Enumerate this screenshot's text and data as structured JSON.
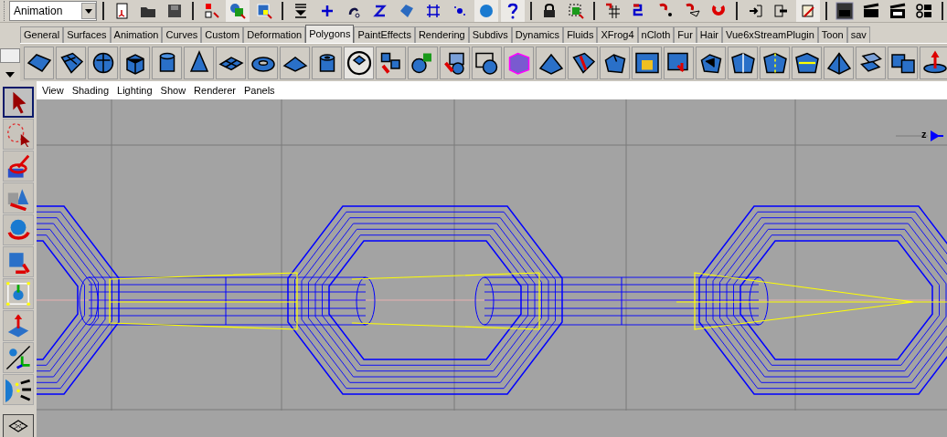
{
  "status_line": {
    "mode_menu": {
      "value": "Animation"
    }
  },
  "shelf": {
    "tabs": [
      {
        "label": "General",
        "selected": false
      },
      {
        "label": "Surfaces",
        "selected": false
      },
      {
        "label": "Animation",
        "selected": false
      },
      {
        "label": "Curves",
        "selected": false
      },
      {
        "label": "Custom",
        "selected": false
      },
      {
        "label": "Deformation",
        "selected": false
      },
      {
        "label": "Polygons",
        "selected": true
      },
      {
        "label": "PaintEffects",
        "selected": false
      },
      {
        "label": "Rendering",
        "selected": false
      },
      {
        "label": "Subdivs",
        "selected": false
      },
      {
        "label": "Dynamics",
        "selected": false
      },
      {
        "label": "Fluids",
        "selected": false
      },
      {
        "label": "XFrog4",
        "selected": false
      },
      {
        "label": "nCloth",
        "selected": false
      },
      {
        "label": "Fur",
        "selected": false
      },
      {
        "label": "Hair",
        "selected": false
      },
      {
        "label": "Vue6xStreamPlugin",
        "selected": false
      },
      {
        "label": "Toon",
        "selected": false
      },
      {
        "label": "sav",
        "selected": false
      }
    ]
  },
  "toolbox": {
    "tools": [
      {
        "kind": "select",
        "selected": true
      },
      {
        "kind": "lasso",
        "selected": false
      },
      {
        "kind": "paint",
        "selected": false
      },
      {
        "kind": "move",
        "selected": false
      },
      {
        "kind": "rotate",
        "selected": false
      },
      {
        "kind": "scale",
        "selected": false
      },
      {
        "kind": "manipulator",
        "selected": false
      },
      {
        "kind": "soft",
        "selected": false
      },
      {
        "kind": "last",
        "selected": false
      },
      {
        "kind": "show",
        "selected": false
      }
    ]
  },
  "panel": {
    "menu": [
      "View",
      "Shading",
      "Lighting",
      "Show",
      "Renderer",
      "Panels"
    ],
    "axis_label": "z"
  }
}
